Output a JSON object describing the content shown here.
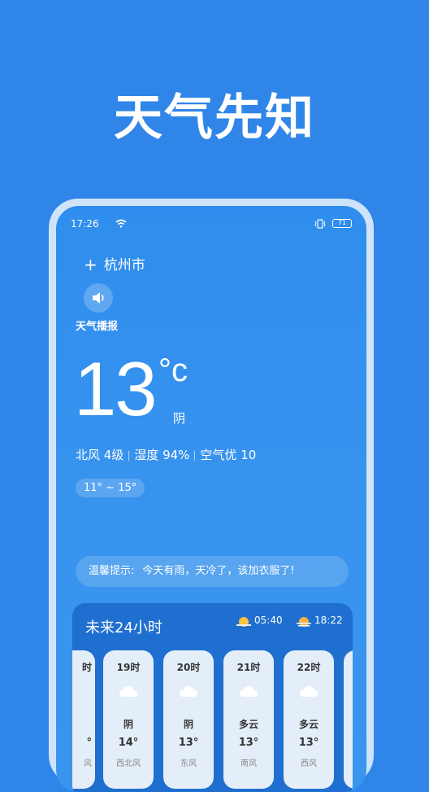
{
  "hero": {
    "title": "天气先知"
  },
  "status": {
    "time": "17:26",
    "battery": "71"
  },
  "location": {
    "city": "杭州市"
  },
  "broadcast": {
    "label": "天气播报"
  },
  "current": {
    "temperature": "13",
    "unit": "°c",
    "condition": "阴",
    "wind": "北风 4级",
    "humidity": "湿度 94%",
    "air": "空气优 10",
    "range": "11° ~ 15°"
  },
  "tip": {
    "label": "温馨提示:",
    "text": "今天有雨，天冷了，该加衣服了!"
  },
  "hourly": {
    "title": "未来24小时",
    "sunrise": "05:40",
    "sunset": "18:22",
    "items": [
      {
        "time": "时",
        "condition": "",
        "temp": "°",
        "wind": "风"
      },
      {
        "time": "19时",
        "condition": "阴",
        "temp": "14°",
        "wind": "西北风"
      },
      {
        "time": "20时",
        "condition": "阴",
        "temp": "13°",
        "wind": "东风"
      },
      {
        "time": "21时",
        "condition": "多云",
        "temp": "13°",
        "wind": "南风"
      },
      {
        "time": "22时",
        "condition": "多云",
        "temp": "13°",
        "wind": "西风"
      }
    ]
  }
}
